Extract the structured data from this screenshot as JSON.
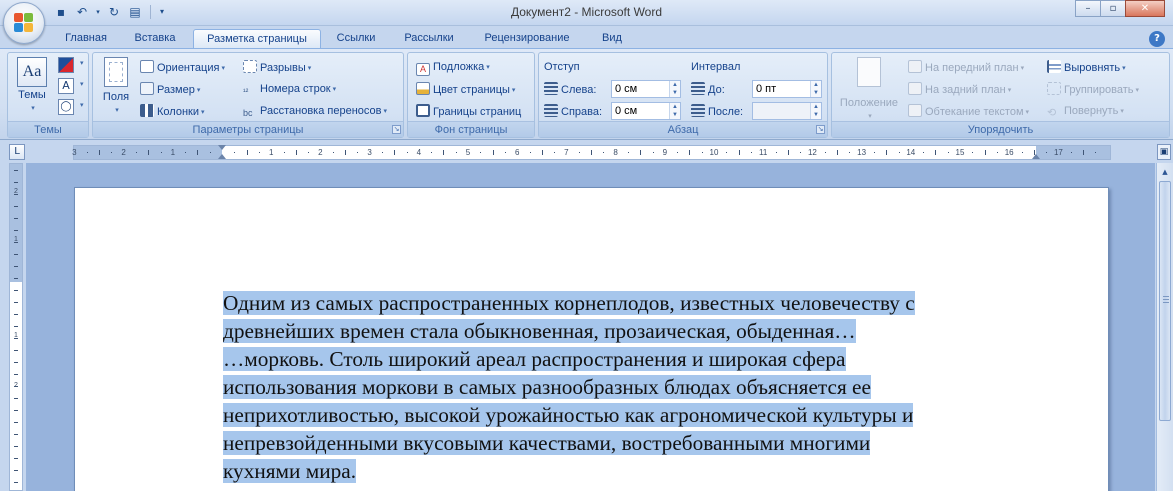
{
  "window": {
    "title": "Документ2 - Microsoft Word",
    "controls": [
      "minimize",
      "maximize",
      "close"
    ]
  },
  "quick_access": {
    "icons": [
      "save-icon",
      "undo-icon",
      "dropdown-icon",
      "redo-icon",
      "print-preview-icon",
      "customize-icon"
    ]
  },
  "tabs": [
    "Главная",
    "Вставка",
    "Разметка страницы",
    "Ссылки",
    "Рассылки",
    "Рецензирование",
    "Вид"
  ],
  "active_tab": "Разметка страницы",
  "ribbon": {
    "themes": {
      "label": "Темы",
      "button": "Темы"
    },
    "page_setup": {
      "label": "Параметры страницы",
      "fields_button": "Поля",
      "orientation": "Ориентация",
      "size": "Размер",
      "columns": "Колонки",
      "breaks": "Разрывы",
      "line_numbers": "Номера строк",
      "hyphenation": "Расстановка переносов"
    },
    "page_background": {
      "label": "Фон страницы",
      "watermark": "Подложка",
      "page_color": "Цвет страницы",
      "page_borders": "Границы страниц"
    },
    "paragraph": {
      "label": "Абзац",
      "indent_title": "Отступ",
      "left_label": "Слева:",
      "left_value": "0 см",
      "right_label": "Справа:",
      "right_value": "0 см",
      "spacing_title": "Интервал",
      "before_label": "До:",
      "before_value": "0 пт",
      "after_label": "После:",
      "after_value": ""
    },
    "arrange": {
      "label": "Упорядочить",
      "position": "Положение",
      "bring_front": "На передний план",
      "send_back": "На задний план",
      "text_wrap": "Обтекание текстом",
      "align": "Выровнять",
      "group": "Группировать",
      "rotate": "Повернуть"
    }
  },
  "ruler": {
    "numbers_left": [
      "3",
      "2",
      "1"
    ],
    "numbers_right": [
      "1",
      "2",
      "3",
      "4",
      "5",
      "6",
      "7",
      "8",
      "9",
      "10",
      "11",
      "12",
      "13",
      "14",
      "15",
      "16",
      "17"
    ],
    "vertical_numbers": [
      "2",
      "1",
      "1",
      "2"
    ]
  },
  "document": {
    "lines": [
      "Одним из самых распространенных корнеплодов, известных человечеству с",
      "древнейших времен стала обыкновенная, прозаическая, обыденная…",
      "…морковь. Столь широкий ареал распространения и широкая сфера",
      "использования моркови в самых разнообразных блюдах объясняется ее",
      "неприхотливостью, высокой урожайностью как агрономической культуры  и",
      "непревзойденными вкусовыми качествами, востребованными многими",
      "кухнями мира."
    ],
    "selection_color": "#a6c6ec"
  },
  "colors": {
    "ribbon_text": "#15428b",
    "selection": "#a6c6ec",
    "workspace": "#97b3dc"
  }
}
